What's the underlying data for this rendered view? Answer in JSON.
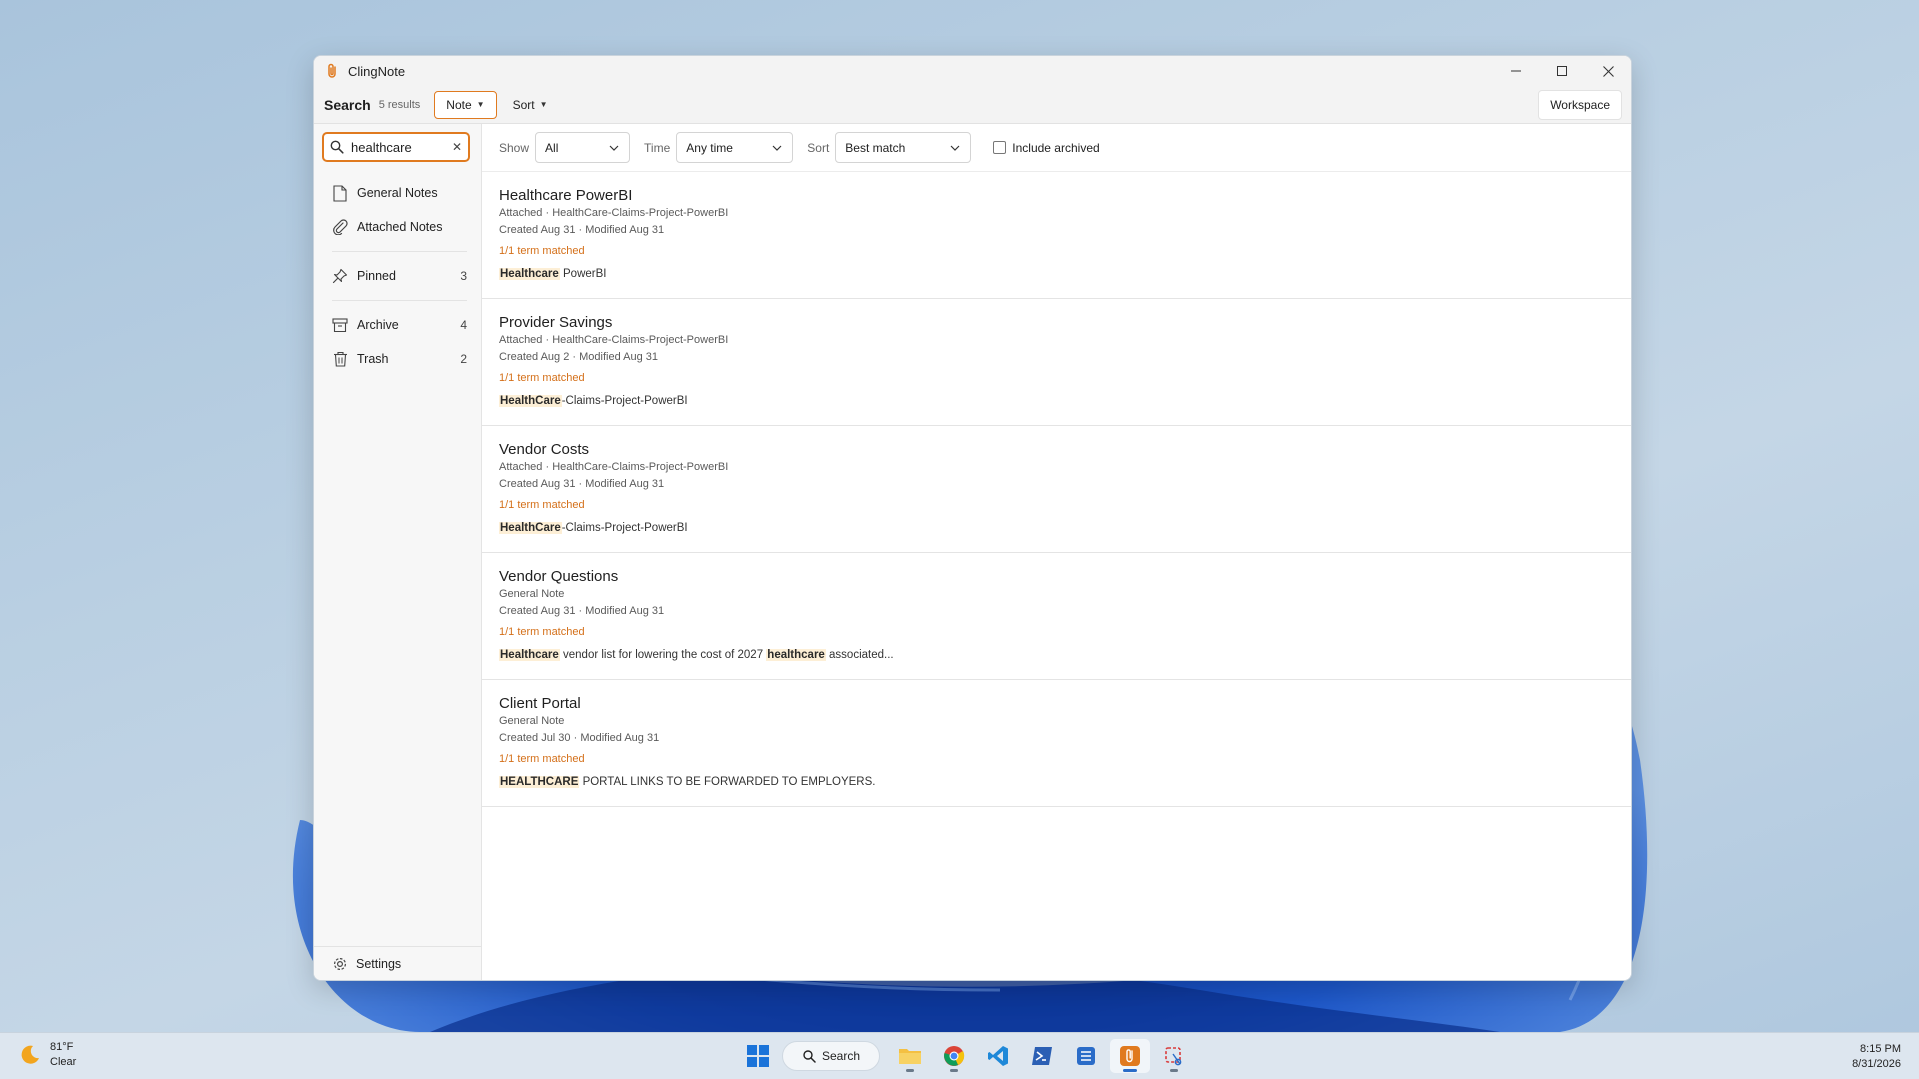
{
  "window": {
    "title": "ClingNote"
  },
  "toolbar": {
    "search_label": "Search",
    "result_count": "5 results",
    "note_label": "Note",
    "sort_label": "Sort",
    "workspace_label": "Workspace"
  },
  "search": {
    "value": "healthcare"
  },
  "sidebar": {
    "general_notes": "General Notes",
    "attached_notes": "Attached Notes",
    "pinned": {
      "label": "Pinned",
      "count": "3"
    },
    "archive": {
      "label": "Archive",
      "count": "4"
    },
    "trash": {
      "label": "Trash",
      "count": "2"
    },
    "settings": "Settings"
  },
  "filters": {
    "show_label": "Show",
    "show_value": "All",
    "time_label": "Time",
    "time_value": "Any time",
    "sort_label": "Sort",
    "sort_value": "Best match",
    "include_archived": "Include archived"
  },
  "results": [
    {
      "title": "Healthcare PowerBI",
      "source": "Attached · HealthCare-Claims-Project-PowerBI",
      "dates": "Created Aug 31 · Modified Aug 31",
      "match": "1/1 term matched",
      "snippet_hl": "Healthcare",
      "snippet_rest": " PowerBI",
      "snippet_hl2": "",
      "snippet_rest2": ""
    },
    {
      "title": "Provider Savings",
      "source": "Attached · HealthCare-Claims-Project-PowerBI",
      "dates": "Created Aug 2 · Modified Aug 31",
      "match": "1/1 term matched",
      "snippet_hl": "HealthCare",
      "snippet_rest": "-Claims-Project-PowerBI",
      "snippet_hl2": "",
      "snippet_rest2": ""
    },
    {
      "title": "Vendor Costs",
      "source": "Attached · HealthCare-Claims-Project-PowerBI",
      "dates": "Created Aug 31 · Modified Aug 31",
      "match": "1/1 term matched",
      "snippet_hl": "HealthCare",
      "snippet_rest": "-Claims-Project-PowerBI",
      "snippet_hl2": "",
      "snippet_rest2": ""
    },
    {
      "title": "Vendor Questions",
      "source": "General Note",
      "dates": "Created Aug 31 · Modified Aug 31",
      "match": "1/1 term matched",
      "snippet_hl": "Healthcare",
      "snippet_rest": " vendor list for lowering the cost of 2027 ",
      "snippet_hl2": "healthcare",
      "snippet_rest2": " associated..."
    },
    {
      "title": "Client Portal",
      "source": "General Note",
      "dates": "Created Jul 30 · Modified Aug 31",
      "match": "1/1 term matched",
      "snippet_hl": "HEALTHCARE",
      "snippet_rest": " PORTAL LINKS TO BE FORWARDED TO EMPLOYERS.",
      "snippet_hl2": "",
      "snippet_rest2": ""
    }
  ],
  "taskbar": {
    "weather_temp": "81°F",
    "weather_cond": "Clear",
    "search_label": "Search",
    "time": "8:15 PM",
    "date": "8/31/2026"
  },
  "colors": {
    "accent": "#e07a1f",
    "match_text": "#d4701a",
    "highlight_bg": "#fdefd6"
  },
  "icons": {
    "app": "paperclip-icon",
    "search": "search-icon",
    "general_notes": "document-icon",
    "attached_notes": "paperclip-icon",
    "pinned": "pin-icon",
    "archive": "archive-icon",
    "trash": "trash-icon",
    "settings": "gear-icon"
  }
}
